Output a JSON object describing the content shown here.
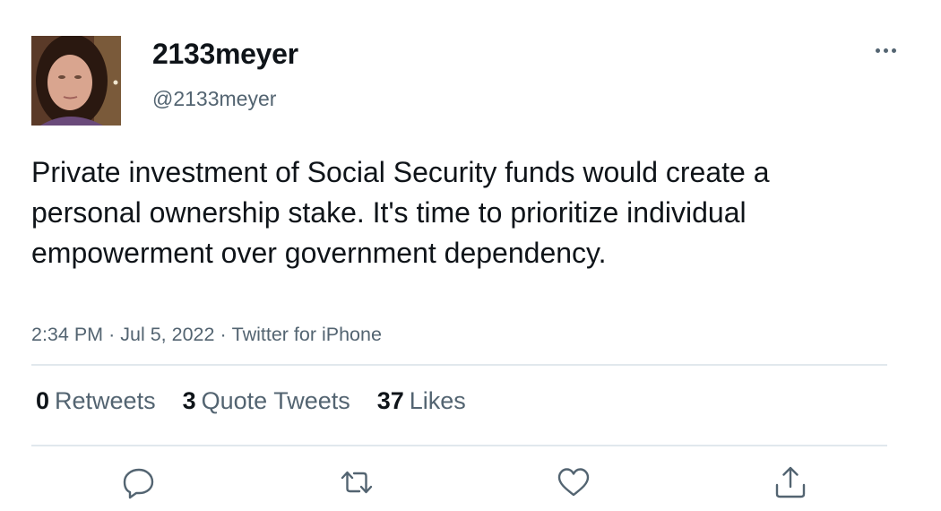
{
  "user": {
    "display_name": "2133meyer",
    "handle": "@2133meyer"
  },
  "tweet": {
    "text": "Private investment of Social Security funds would create a personal ownership stake. It's time to prioritize individual empowerment over government dependency.",
    "time": "2:34 PM",
    "separator": "·",
    "date": "Jul 5, 2022",
    "source": "Twitter for iPhone"
  },
  "stats": {
    "retweets_count": "0",
    "retweets_label": "Retweets",
    "quotes_count": "3",
    "quotes_label": "Quote Tweets",
    "likes_count": "37",
    "likes_label": "Likes"
  },
  "actions": {
    "reply_icon": "reply-icon",
    "retweet_icon": "retweet-icon",
    "like_icon": "heart-icon",
    "share_icon": "share-icon"
  },
  "colors": {
    "text_primary": "#0f1419",
    "text_secondary": "#536471",
    "divider": "#e1e8ed"
  }
}
